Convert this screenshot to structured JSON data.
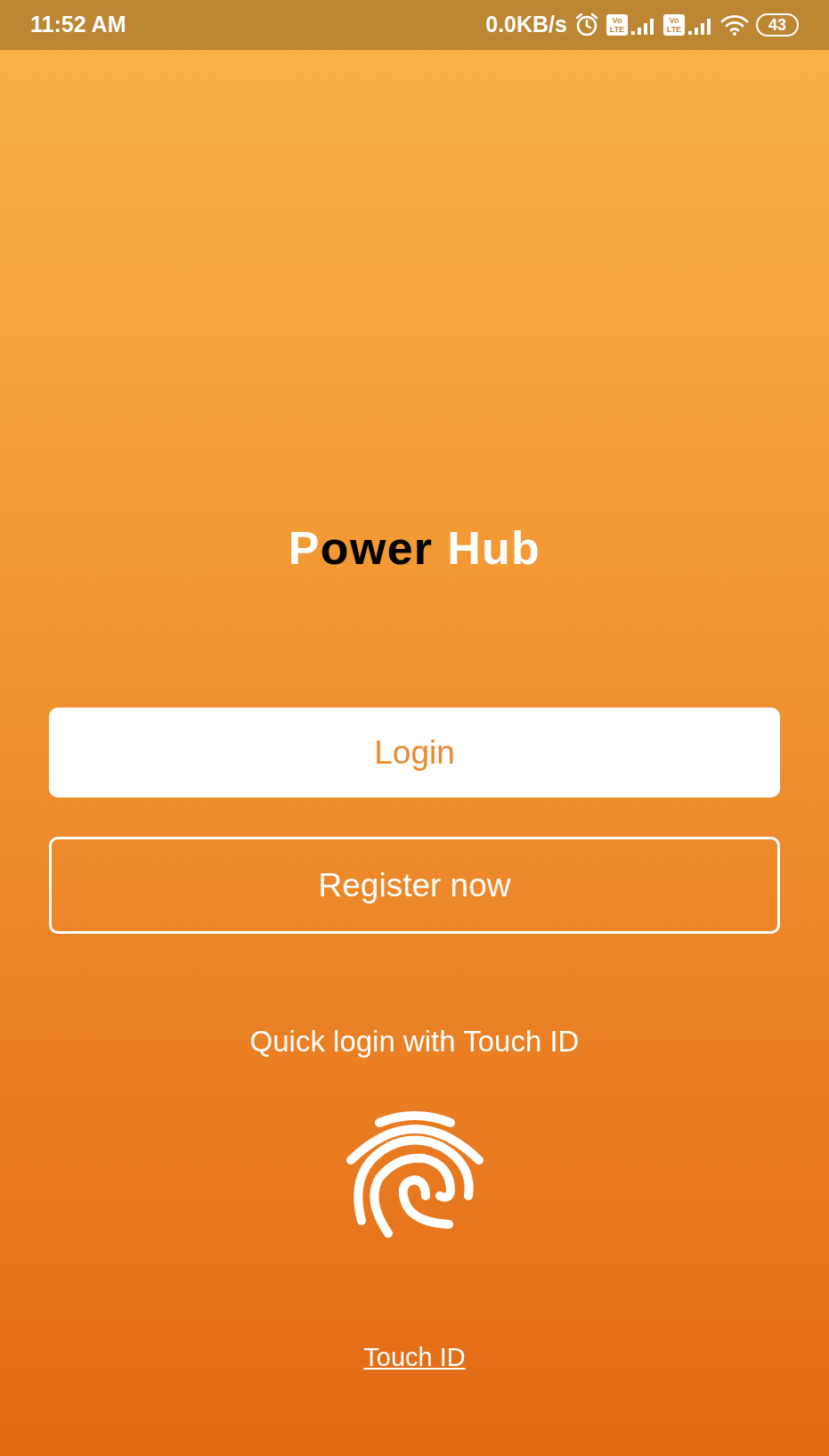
{
  "status_bar": {
    "time": "11:52 AM",
    "speed": "0.0KB/s",
    "sim_badges": [
      "Vo LTE",
      "Vo LTE"
    ],
    "battery": "43"
  },
  "title": {
    "parts": [
      {
        "text": "P",
        "dark": false
      },
      {
        "text": "ower",
        "dark": true
      },
      {
        "text": " Hub",
        "dark": false
      }
    ]
  },
  "buttons": [
    {
      "label": "Login",
      "kind": "filled"
    },
    {
      "label": "Register now",
      "kind": "outline"
    }
  ],
  "touch_prompt": "Quick login with Touch ID",
  "touch_link": "Touch ID"
}
